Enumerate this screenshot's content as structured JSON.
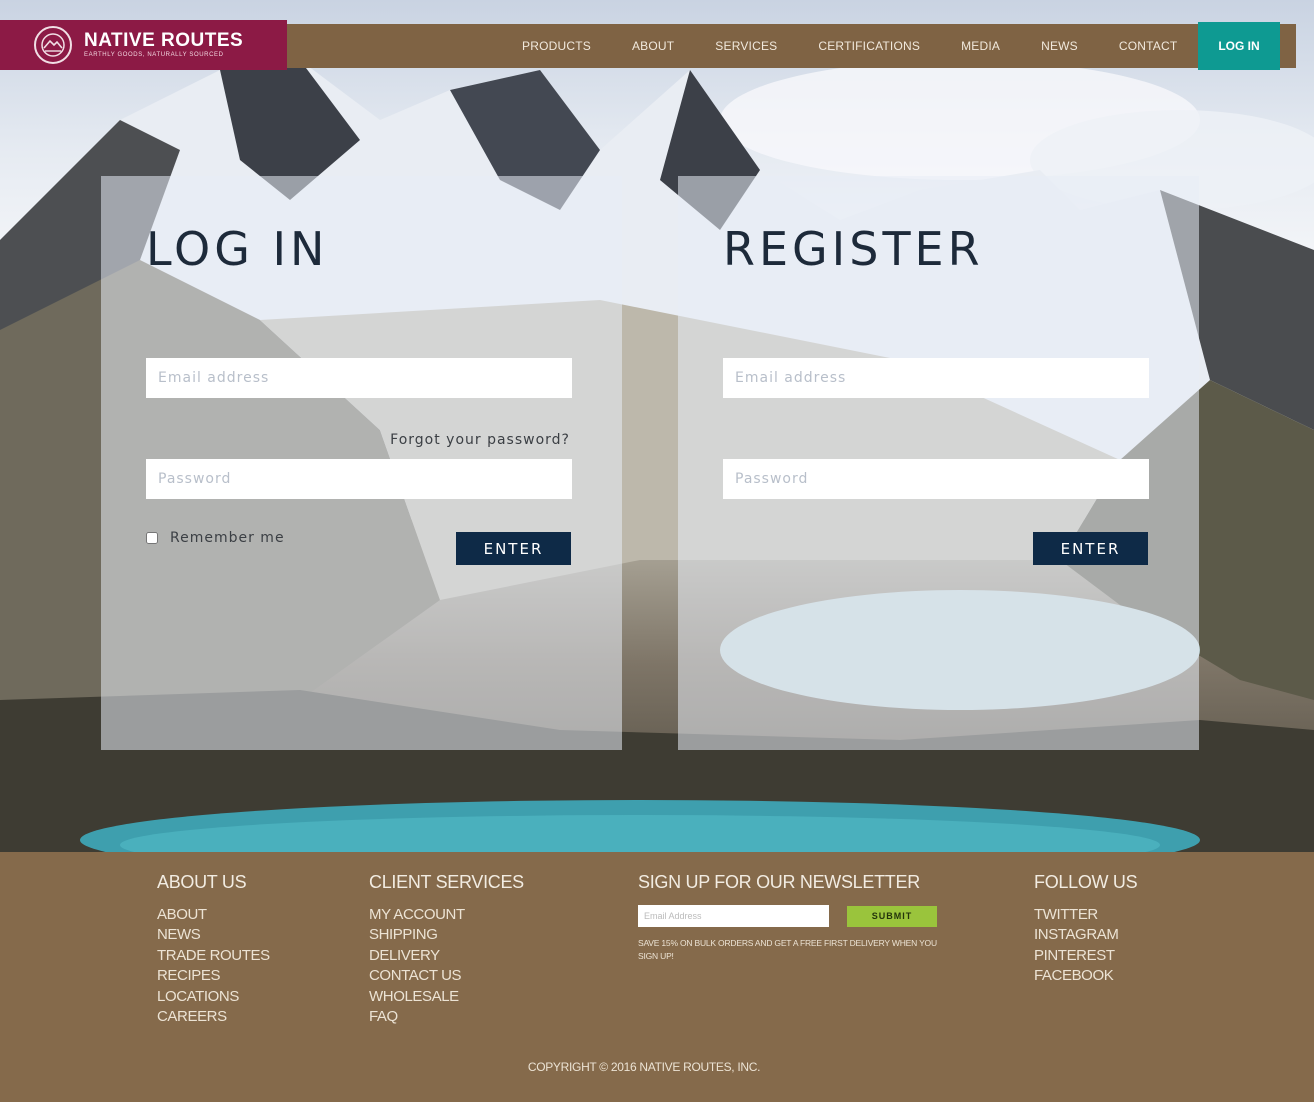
{
  "brand": {
    "name": "NATIVE ROUTES",
    "tagline": "EARTHLY GOODS, NATURALLY SOURCED",
    "colors": {
      "logo_bg": "#8c1a45",
      "nav_bg": "#7f6344",
      "login_btn": "#0e9a92",
      "footer_bg": "#856a4b",
      "button_dark": "#0e2a47",
      "submit_green": "#9ac43c"
    }
  },
  "nav": {
    "items": [
      "PRODUCTS",
      "ABOUT",
      "SERVICES",
      "CERTIFICATIONS",
      "MEDIA",
      "NEWS",
      "CONTACT"
    ],
    "login_label": "LOG IN"
  },
  "login": {
    "title": "LOG IN",
    "email_placeholder": "Email address",
    "password_placeholder": "Password",
    "forgot": "Forgot your password?",
    "remember": "Remember me",
    "enter": "ENTER"
  },
  "register": {
    "title": "REGISTER",
    "email_placeholder": "Email address",
    "password_placeholder": "Password",
    "enter": "ENTER"
  },
  "footer": {
    "about": {
      "heading": "ABOUT US",
      "links": [
        "ABOUT",
        "NEWS",
        "TRADE ROUTES",
        "RECIPES",
        "LOCATIONS",
        "CAREERS"
      ]
    },
    "client": {
      "heading": "CLIENT SERVICES",
      "links": [
        "MY ACCOUNT",
        "SHIPPING",
        "DELIVERY",
        "CONTACT US",
        "WHOLESALE",
        "FAQ"
      ]
    },
    "newsletter": {
      "heading": "SIGN UP FOR OUR NEWSLETTER",
      "placeholder": "Email Address",
      "submit": "SUBMIT",
      "note": "SAVE 15% ON BULK ORDERS AND GET A FREE FIRST DELIVERY WHEN YOU SIGN UP!"
    },
    "follow": {
      "heading": "FOLLOW US",
      "links": [
        "TWITTER",
        "INSTAGRAM",
        "PINTEREST",
        "FACEBOOK"
      ]
    },
    "copyright": "COPYRIGHT © 2016 NATIVE ROUTES, INC."
  },
  "icons": {
    "logo": "mountain-sun-emblem-icon",
    "checkbox": "checkbox-icon"
  }
}
